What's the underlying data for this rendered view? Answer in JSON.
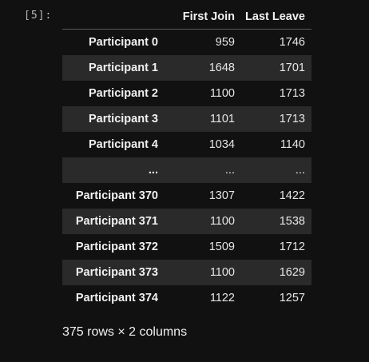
{
  "prompt": "[5]:",
  "table": {
    "columns": [
      "First Join",
      "Last Leave"
    ],
    "rows": [
      {
        "index": "Participant 0",
        "values": [
          "959",
          "1746"
        ]
      },
      {
        "index": "Participant 1",
        "values": [
          "1648",
          "1701"
        ]
      },
      {
        "index": "Participant 2",
        "values": [
          "1100",
          "1713"
        ]
      },
      {
        "index": "Participant 3",
        "values": [
          "1101",
          "1713"
        ]
      },
      {
        "index": "Participant 4",
        "values": [
          "1034",
          "1140"
        ]
      },
      {
        "index": "...",
        "values": [
          "...",
          "..."
        ]
      },
      {
        "index": "Participant 370",
        "values": [
          "1307",
          "1422"
        ]
      },
      {
        "index": "Participant 371",
        "values": [
          "1100",
          "1538"
        ]
      },
      {
        "index": "Participant 372",
        "values": [
          "1509",
          "1712"
        ]
      },
      {
        "index": "Participant 373",
        "values": [
          "1100",
          "1629"
        ]
      },
      {
        "index": "Participant 374",
        "values": [
          "1122",
          "1257"
        ]
      }
    ]
  },
  "summary": "375 rows × 2 columns"
}
